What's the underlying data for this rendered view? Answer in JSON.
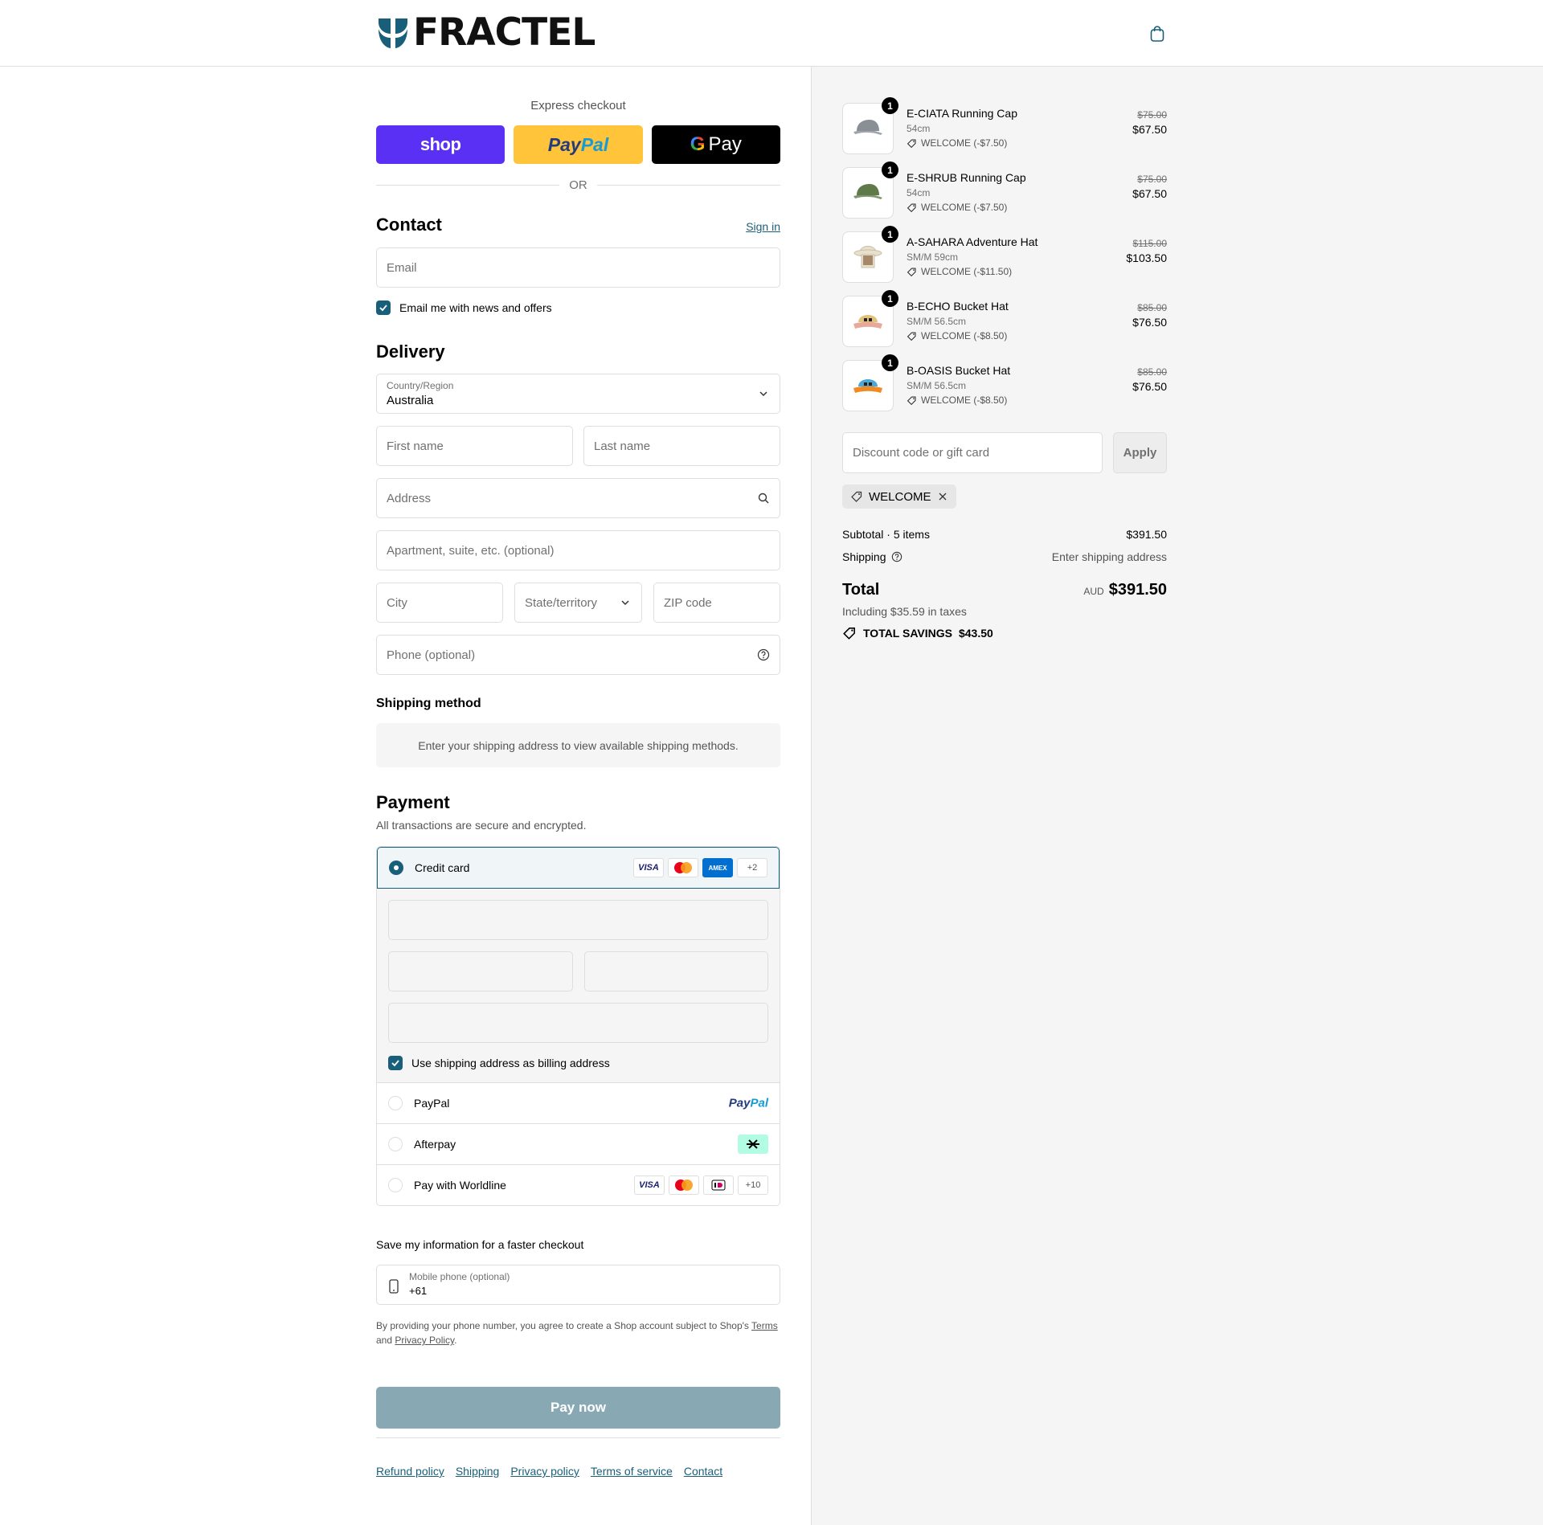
{
  "brand": {
    "name": "FRACTEL"
  },
  "colors": {
    "accent": "#1a5f7a",
    "shop": "#5a31f4",
    "paypal": "#ffc439",
    "gpay": "#000000",
    "paynow": "#88a9b4"
  },
  "express": {
    "title": "Express checkout",
    "shop_label": "shop",
    "paypal_a": "Pay",
    "paypal_b": "Pal",
    "gpay_g": "G",
    "gpay_label": "Pay",
    "or": "OR"
  },
  "contact": {
    "title": "Contact",
    "sign_in": "Sign in",
    "email_placeholder": "Email",
    "news_label": "Email me with news and offers"
  },
  "delivery": {
    "title": "Delivery",
    "country_label": "Country/Region",
    "country_value": "Australia",
    "first_name": "First name",
    "last_name": "Last name",
    "address": "Address",
    "apartment": "Apartment, suite, etc. (optional)",
    "city": "City",
    "state": "State/territory",
    "zip": "ZIP code",
    "phone": "Phone (optional)"
  },
  "shipping_method": {
    "title": "Shipping method",
    "message": "Enter your shipping address to view available shipping methods."
  },
  "payment": {
    "title": "Payment",
    "subtitle": "All transactions are secure and encrypted.",
    "credit_card": "Credit card",
    "visa": "VISA",
    "amex": "AMEX",
    "cc_more": "+2",
    "billing_label": "Use shipping address as billing address",
    "paypal": "PayPal",
    "paypal_logo_a": "Pay",
    "paypal_logo_b": "Pal",
    "afterpay": "Afterpay",
    "worldline": "Pay with Worldline",
    "wl_more": "+10"
  },
  "save_info": {
    "title": "Save my information for a faster checkout",
    "mobile_label": "Mobile phone (optional)",
    "mobile_value": "+61",
    "legal_a": "By providing your phone number, you agree to create a Shop account subject to Shop's ",
    "terms": "Terms",
    "legal_b": "and ",
    "privacy": "Privacy Policy",
    "legal_c": "."
  },
  "pay_now": "Pay now",
  "footer": [
    "Refund policy",
    "Shipping",
    "Privacy policy",
    "Terms of service",
    "Contact"
  ],
  "items": [
    {
      "name": "E-CIATA Running Cap",
      "variant": "54cm",
      "discount": "WELCOME (-$7.50)",
      "orig": "$75.00",
      "price": "$67.50",
      "qty": "1",
      "color": "#8a8f96"
    },
    {
      "name": "E-SHRUB Running Cap",
      "variant": "54cm",
      "discount": "WELCOME (-$7.50)",
      "orig": "$75.00",
      "price": "$67.50",
      "qty": "1",
      "color": "#5f7a48"
    },
    {
      "name": "A-SAHARA Adventure Hat",
      "variant": "SM/M 59cm",
      "discount": "WELCOME (-$11.50)",
      "orig": "$115.00",
      "price": "$103.50",
      "qty": "1",
      "color": "#e8e0cc"
    },
    {
      "name": "B-ECHO Bucket Hat",
      "variant": "SM/M 56.5cm",
      "discount": "WELCOME (-$8.50)",
      "orig": "$85.00",
      "price": "$76.50",
      "qty": "1",
      "color": "#e2c27a"
    },
    {
      "name": "B-OASIS Bucket Hat",
      "variant": "SM/M 56.5cm",
      "discount": "WELCOME (-$8.50)",
      "orig": "$85.00",
      "price": "$76.50",
      "qty": "1",
      "color": "#4aa7d6"
    }
  ],
  "discount": {
    "placeholder": "Discount code or gift card",
    "apply": "Apply",
    "chip": "WELCOME"
  },
  "totals": {
    "subtotal_label": "Subtotal · 5 items",
    "subtotal": "$391.50",
    "shipping_label": "Shipping",
    "shipping_value": "Enter shipping address",
    "total_label": "Total",
    "currency": "AUD",
    "total": "$391.50",
    "taxes": "Including $35.59 in taxes",
    "savings_label": "TOTAL SAVINGS",
    "savings": "$43.50"
  }
}
